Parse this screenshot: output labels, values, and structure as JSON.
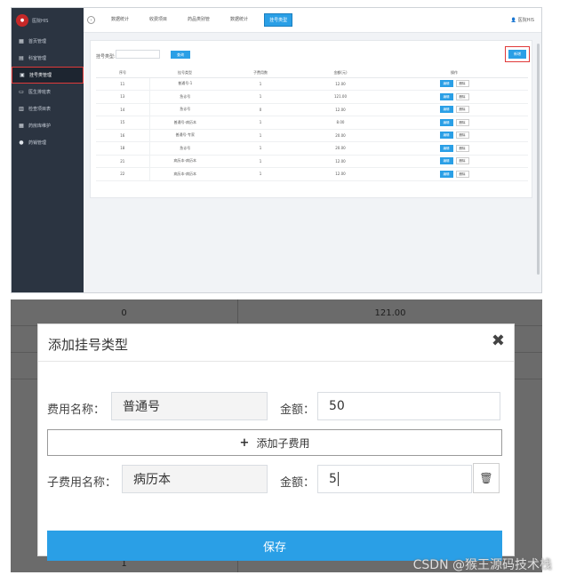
{
  "top": {
    "logo_badge": "●",
    "logo_text": "医院HIS",
    "sidebar": [
      {
        "label": "首页管理",
        "icon": "▦"
      },
      {
        "label": "科室管理",
        "icon": "▤"
      },
      {
        "label": "挂号类管理",
        "icon": "▣",
        "active": true
      },
      {
        "label": "医生排班表",
        "icon": "▭"
      },
      {
        "label": "检查项目表",
        "icon": "▥"
      },
      {
        "label": "药房库维护",
        "icon": "▦"
      },
      {
        "label": "药销管理",
        "icon": "●"
      }
    ],
    "tabs": [
      {
        "label": "数据统计"
      },
      {
        "label": "收费项目"
      },
      {
        "label": "药品类别管"
      },
      {
        "label": "数据统计"
      },
      {
        "label": "挂号类型",
        "active": true
      }
    ],
    "circle_icon": "‹",
    "user": "👤 医院HIS",
    "search_label": "挂号类型:",
    "search_btn": "查询",
    "add_btn": "新增",
    "columns": [
      "序号",
      "挂号类型",
      "子费用数",
      "金额(元)",
      "操作"
    ],
    "rows": [
      {
        "id": "11",
        "name": "普通号-1",
        "count": "1",
        "amount": "12.00"
      },
      {
        "id": "13",
        "name": "急诊号",
        "count": "1",
        "amount": "121.00"
      },
      {
        "id": "14",
        "name": "急诊号",
        "count": "0",
        "amount": "12.00"
      },
      {
        "id": "15",
        "name": "普通号-病历本",
        "count": "1",
        "amount": "8.00"
      },
      {
        "id": "16",
        "name": "普通号-专家",
        "count": "1",
        "amount": "20.00"
      },
      {
        "id": "18",
        "name": "急诊号",
        "count": "1",
        "amount": "20.00"
      },
      {
        "id": "21",
        "name": "病历本-病历本",
        "count": "1",
        "amount": "12.00"
      },
      {
        "id": "22",
        "name": "病历本-病历本",
        "count": "1",
        "amount": "12.00"
      }
    ],
    "edit_label": "编辑",
    "delete_label": "删除"
  },
  "bottom": {
    "bg_top_left": "0",
    "bg_top_right": "121.00",
    "bg_bottom_left": "1",
    "modal_title": "添加挂号类型",
    "close_icon": "✖",
    "fee_name_label": "费用名称：",
    "fee_name_value": "普通号",
    "amount_label": "金额：",
    "amount_value": "50",
    "add_child_plus": "+",
    "add_child_label": "添加子费用",
    "child_name_label": "子费用名称：",
    "child_name_value": "病历本",
    "child_amount_label": "金额：",
    "child_amount_value": "5",
    "trash_icon": "🗑",
    "save_label": "保存"
  },
  "watermark": "CSDN @猴王源码技术栈"
}
